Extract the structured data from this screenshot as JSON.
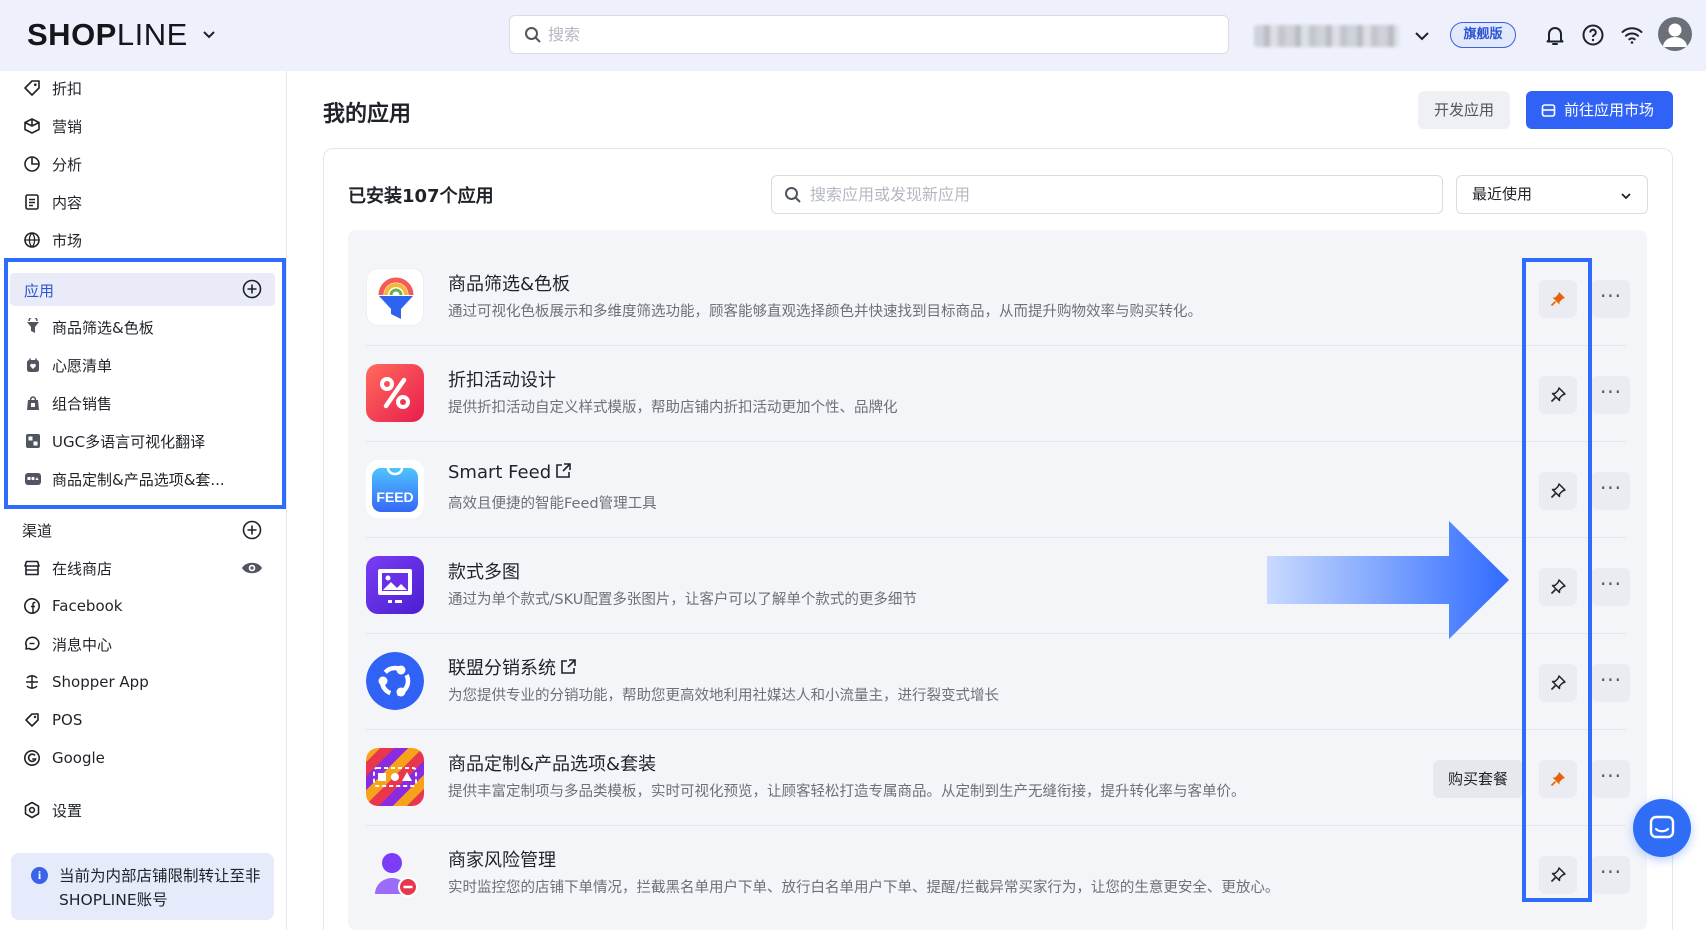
{
  "header": {
    "logo_bold": "SHOP",
    "logo_light": "LINE",
    "search_placeholder": "搜索",
    "plan_badge": "旗舰版"
  },
  "sidebar": {
    "top_items": [
      {
        "label": "折扣",
        "icon": "tag-icon"
      },
      {
        "label": "营销",
        "icon": "megaphone-icon"
      },
      {
        "label": "分析",
        "icon": "pie-chart-icon"
      },
      {
        "label": "内容",
        "icon": "document-icon"
      },
      {
        "label": "市场",
        "icon": "globe-icon"
      }
    ],
    "apps_label": "应用",
    "apps": [
      {
        "label": "商品筛选&色板",
        "icon": "filter-app-icon"
      },
      {
        "label": "心愿清单",
        "icon": "wishlist-app-icon"
      },
      {
        "label": "组合销售",
        "icon": "bundle-app-icon"
      },
      {
        "label": "UGC多语言可视化翻译",
        "icon": "translate-app-icon"
      },
      {
        "label": "商品定制&产品选项&套...",
        "icon": "customize-app-icon"
      }
    ],
    "channels_label": "渠道",
    "channels": [
      {
        "label": "在线商店",
        "icon": "store-icon"
      },
      {
        "label": "Facebook",
        "icon": "facebook-icon"
      },
      {
        "label": "消息中心",
        "icon": "message-icon"
      },
      {
        "label": "Shopper App",
        "icon": "shopper-app-icon"
      },
      {
        "label": "POS",
        "icon": "pos-icon"
      },
      {
        "label": "Google",
        "icon": "google-icon"
      }
    ],
    "settings_label": "设置",
    "notice": "当前为内部店铺限制转让至非SHOPLINE账号"
  },
  "main": {
    "title": "我的应用",
    "dev_button": "开发应用",
    "market_button": "前往应用市场",
    "installed_label": "已安装107个应用",
    "search_placeholder": "搜索应用或发现新应用",
    "sort_value": "最近使用",
    "apps": [
      {
        "name": "商品筛选&色板",
        "desc": "通过可视化色板展示和多维度筛选功能，顾客能够直观选择颜色并快速找到目标商品，从而提升购物效率与购买转化。",
        "pinned": true,
        "external": false
      },
      {
        "name": "折扣活动设计",
        "desc": "提供折扣活动自定义样式模版，帮助店铺内折扣活动更加个性、品牌化",
        "pinned": false,
        "external": false
      },
      {
        "name": "Smart Feed",
        "desc": "高效且便捷的智能Feed管理工具",
        "pinned": false,
        "external": true,
        "logo_text": "FEED"
      },
      {
        "name": "款式多图",
        "desc": "通过为单个款式/SKU配置多张图片，让客户可以了解单个款式的更多细节",
        "pinned": false,
        "external": false
      },
      {
        "name": "联盟分销系统",
        "desc": "为您提供专业的分销功能，帮助您更高效地利用社媒达人和小流量主，进行裂变式增长",
        "pinned": false,
        "external": true
      },
      {
        "name": "商品定制&产品选项&套装",
        "desc": "提供丰富定制项与多品类模板，实时可视化预览，让顾客轻松打造专属商品。从定制到生产无缝衔接，提升转化率与客单价。",
        "pinned": true,
        "external": false,
        "buy_label": "购买套餐"
      },
      {
        "name": "商家风险管理",
        "desc": "实时监控您的店铺下单情况，拦截黑名单用户下单、放行白名单用户下单、提醒/拦截异常买家行为，让您的生意更安全、更放心。",
        "pinned": false,
        "external": false
      }
    ],
    "more_glyph": "···"
  },
  "colors": {
    "accent": "#2f62f5",
    "highlight_border": "#2f6bff",
    "pin_active": "#e8620c",
    "header_bg": "#eef1fb"
  }
}
